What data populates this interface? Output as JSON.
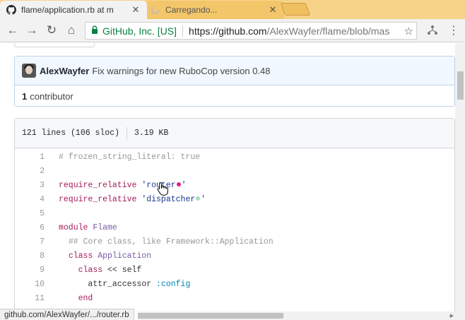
{
  "tabs": [
    {
      "title": "flame/application.rb at m",
      "icon": "github-icon",
      "close": "✕"
    },
    {
      "title": "Carregando...",
      "icon": "loading-spinner-icon",
      "close": "✕"
    }
  ],
  "toolbar": {
    "back": "←",
    "forward": "→",
    "reload": "↻",
    "home": "⌂",
    "secure_org": "GitHub, Inc. [US]",
    "url_host": "https://github.com",
    "url_path": "/AlexWayfer/flame/blob/mas",
    "star": "☆",
    "extension_icon": "extension-icon",
    "menu": "⋮"
  },
  "commit": {
    "author": "AlexWayfer",
    "message": "Fix warnings for new RuboCop version 0.48"
  },
  "contributors": {
    "count": "1",
    "label": "contributor"
  },
  "file_info": {
    "lines": "121 lines (106 sloc)",
    "size": "3.19 KB"
  },
  "code_lines": [
    {
      "n": "1",
      "text": "# frozen_string_literal: true"
    },
    {
      "n": "2",
      "text": ""
    },
    {
      "n": "3",
      "text": "require_relative 'router'"
    },
    {
      "n": "4",
      "text": "require_relative 'dispatcher'"
    },
    {
      "n": "5",
      "text": ""
    },
    {
      "n": "6",
      "text": "module Flame"
    },
    {
      "n": "7",
      "text": "## Core class, like Framework::Application"
    },
    {
      "n": "8",
      "text": "class Application"
    },
    {
      "n": "9",
      "text": "class << self"
    },
    {
      "n": "10",
      "text": "attr_accessor :config"
    },
    {
      "n": "11",
      "text": "end"
    }
  ],
  "status_bar": {
    "text": "github.com/AlexWayfer/.../router.rb"
  },
  "colors": {
    "tab_strip": "#f7d38a",
    "secure_green": "#0b8043",
    "keyword": "#a71d5d",
    "string": "#183691",
    "comment": "#969896",
    "symbol": "#0086b3",
    "class_name": "#795da3",
    "commit_bg": "#f1f8ff"
  }
}
